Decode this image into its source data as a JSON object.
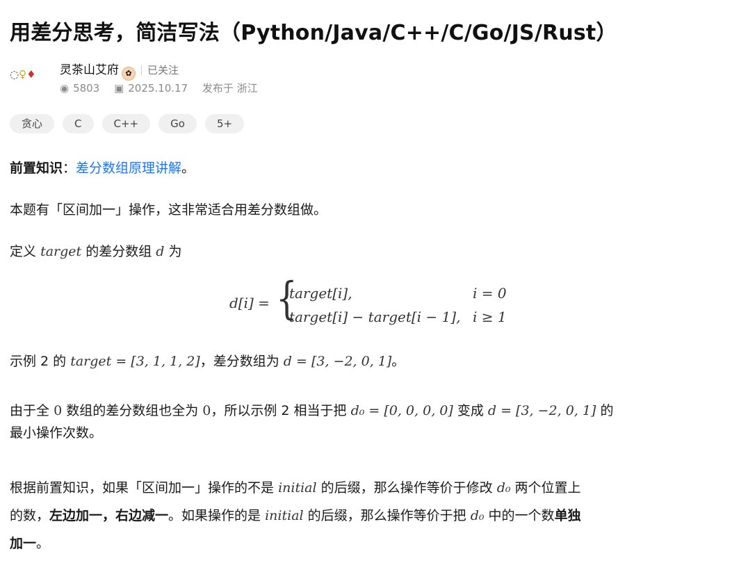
{
  "article": {
    "title": "用差分思考，简洁写法（Python/Java/C++/C/Go/JS/Rust）",
    "author": "灵茶山艾府",
    "follow_status": "已关注",
    "views": "5803",
    "date": "2025.10.17",
    "location": "发布于 浙江"
  },
  "tags": [
    "贪心",
    "C",
    "C++",
    "Go",
    "5+"
  ],
  "content": {
    "prereq_label": "前置知识",
    "prereq_colon": "：",
    "prereq_link": "差分数组原理讲解",
    "prereq_end": "。",
    "p1": "本题有「区间加一」操作，这非常适合用差分数组做。",
    "p2_a": "定义",
    "p2_target": "target",
    "p2_b": "的差分数组",
    "p2_d": "d",
    "p2_c": "为",
    "formula_lhs": "d[i] =",
    "formula_case1": "target[i],",
    "formula_cond1": "i = 0",
    "formula_case2": "target[i] − target[i − 1],",
    "formula_cond2": "i ≥ 1",
    "p3_a": "示例 2 的",
    "p3_expr1": "target = [3, 1, 1, 2]",
    "p3_b": "，差分数组为",
    "p3_expr2": "d = [3, −2, 0, 1]",
    "p3_c": "。",
    "p4_a": "由于全",
    "p4_zero1": "0",
    "p4_b": "数组的差分数组也全为",
    "p4_zero2": "0",
    "p4_c": "，所以示例 2 相当于把",
    "p4_expr1": "d₀ = [0, 0, 0, 0]",
    "p4_d": "变成",
    "p4_expr2": "d = [3, −2, 0, 1]",
    "p4_e": "的",
    "p4_f": "最小操作次数。",
    "p5_a": "根据前置知识，如果「区间加一」操作的不是",
    "p5_initial1": "initial",
    "p5_b": "的后缀，那么操作等价于修改",
    "p5_d0_1": "d₀",
    "p5_c": "两个位置上",
    "p5_d": "的数，",
    "p5_bold1": "左边加一，右边减一",
    "p5_e": "。如果操作的是",
    "p5_initial2": "initial",
    "p5_f": "的后缀，那么操作等价于把",
    "p5_d0_2": "d₀",
    "p5_g": "中的一个数",
    "p5_bold2": "单独",
    "p5_bold3": "加一",
    "p5_h": "。"
  }
}
